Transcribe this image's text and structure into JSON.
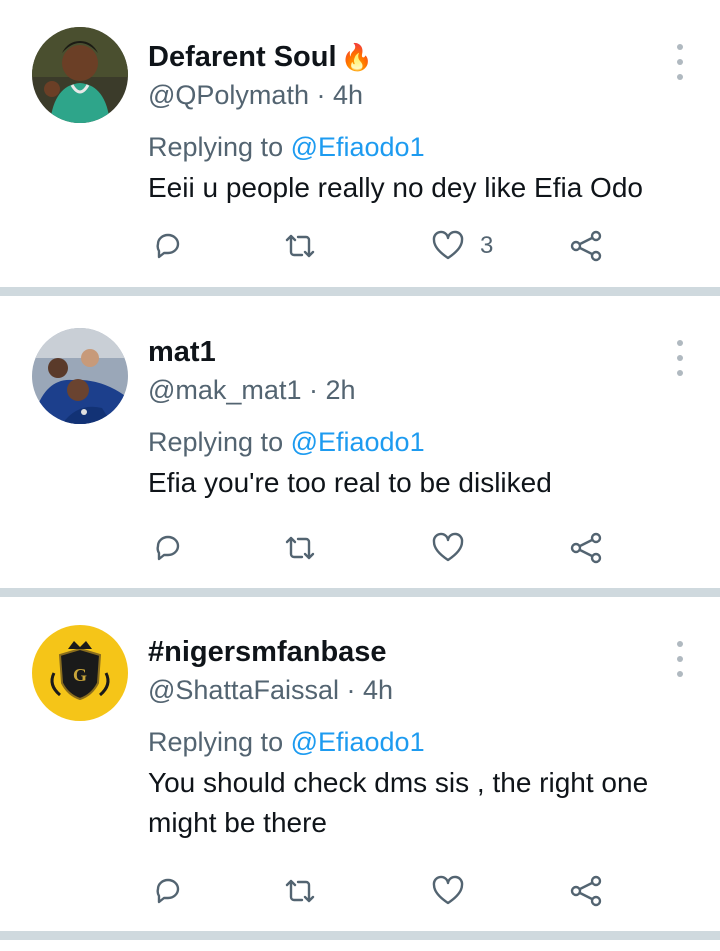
{
  "tweets": [
    {
      "display_name": "Defarent Soul",
      "name_emoji": "🔥",
      "handle": "@QPolymath",
      "time": "4h",
      "replying_prefix": "Replying to ",
      "replying_to": "@Efiaodo1",
      "text": "Eeii u people really no dey like Efia Odo",
      "likes": "3"
    },
    {
      "display_name": "mat1",
      "name_emoji": "",
      "handle": "@mak_mat1",
      "time": "2h",
      "replying_prefix": "Replying to ",
      "replying_to": "@Efiaodo1",
      "text": "Efia you're too real to be disliked",
      "likes": ""
    },
    {
      "display_name": "#nigersmfanbase",
      "name_emoji": "",
      "handle": "@ShattaFaissal",
      "time": "4h",
      "replying_prefix": "Replying to ",
      "replying_to": "@Efiaodo1",
      "text": "You should check dms sis , the right one might be there",
      "likes": ""
    }
  ],
  "separator_char": " · ",
  "icons": {
    "reply": "reply-icon",
    "retweet": "retweet-icon",
    "like": "heart-icon",
    "share": "share-icon",
    "more": "more-vertical-icon"
  },
  "colors": {
    "link": "#1d9bf0",
    "muted": "#536471",
    "text": "#0f1419",
    "divider": "#cfd9de",
    "avatar3_bg": "#f5c518"
  }
}
